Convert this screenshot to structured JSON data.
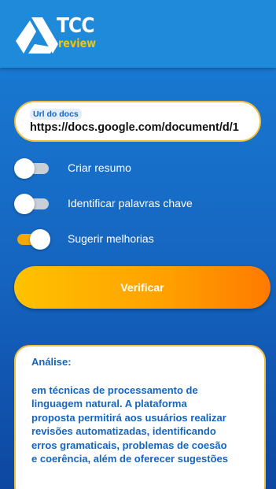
{
  "header": {
    "logo_title": "TCC",
    "logo_subtitle": "review"
  },
  "url_field": {
    "label": "Url do docs",
    "value": "https://docs.google.com/document/d/1"
  },
  "options": [
    {
      "label": "Criar resumo",
      "on": false
    },
    {
      "label": "Identificar palavras chave",
      "on": false
    },
    {
      "label": "Sugerir melhorias",
      "on": true
    }
  ],
  "verify_button": {
    "label": "Verificar"
  },
  "analysis": {
    "title": "Análise:",
    "lines": [
      "em técnicas de processamento de",
      "linguagem natural. A plataforma",
      "proposta permitirá aos usuários realizar",
      "revisões automatizadas, identificando",
      "erros gramaticais, problemas de coesão",
      "e coerência, além de oferecer sugestões"
    ]
  },
  "colors": {
    "primary": "#1565c0",
    "header": "#1e8ad9",
    "accent": "#f6c400",
    "button_start": "#ffc200",
    "button_end": "#ff7a00"
  },
  "icons": {
    "logo": "google-drive-logo-icon"
  }
}
